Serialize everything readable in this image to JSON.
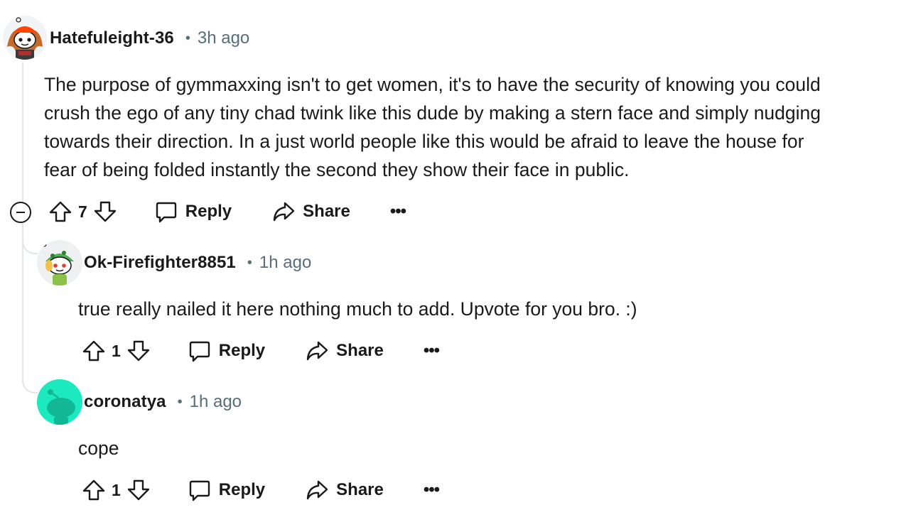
{
  "colors": {
    "text": "#1a1a1b",
    "meta": "#576f76",
    "thread_line": "#e2e5e7",
    "teal_avatar": "#1de9c0"
  },
  "comments": [
    {
      "username": "Hatefuleight-36",
      "separator": "•",
      "time": "3h ago",
      "body": "The purpose of gymmaxxing isn't to get women, it's to have the security of knowing you could\ncrush the ego of any tiny chad twink like this dude by making a stern face and simply nudging\ntowards their direction. In a just world people like this would be afraid to leave the house for\nfear of being folded instantly the second they show their face in public.",
      "score": "7",
      "reply_label": "Reply",
      "share_label": "Share",
      "more_label": "•••",
      "avatar_icon": "snoo-avatar-orange-hat"
    },
    {
      "username": "Ok-Firefighter8851",
      "separator": "•",
      "time": "1h ago",
      "body": "true really nailed it here nothing much to add. Upvote for you bro. :)",
      "score": "1",
      "reply_label": "Reply",
      "share_label": "Share",
      "more_label": "•••",
      "avatar_icon": "snoo-avatar-green-hat"
    },
    {
      "username": "coronatya",
      "separator": "•",
      "time": "1h ago",
      "body": "cope",
      "score": "1",
      "reply_label": "Reply",
      "share_label": "Share",
      "more_label": "•••",
      "avatar_icon": "snoo-default-teal"
    }
  ]
}
